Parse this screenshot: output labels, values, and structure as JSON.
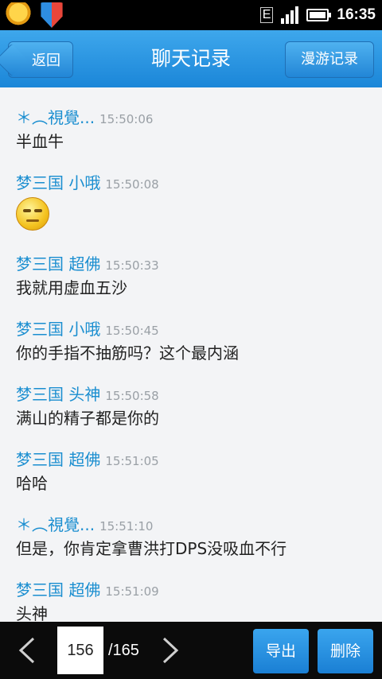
{
  "status_bar": {
    "network_label": "E",
    "time": "16:35"
  },
  "header": {
    "back_label": "返回",
    "title": "聊天记录",
    "roam_label": "漫游记录"
  },
  "messages": [
    {
      "sender": "＊︵視覺...",
      "time": "15:50:06",
      "text": "半血牛"
    },
    {
      "sender": "梦三国 小哦",
      "time": "15:50:08",
      "text": "",
      "emoji": "smug-face-emoji"
    },
    {
      "sender": "梦三国 超佛",
      "time": "15:50:33",
      "text": "我就用虚血五沙"
    },
    {
      "sender": "梦三国 小哦",
      "time": "15:50:45",
      "text": "你的手指不抽筋吗？这个最内涵"
    },
    {
      "sender": "梦三国 头神",
      "time": "15:50:58",
      "text": "满山的精子都是你的"
    },
    {
      "sender": "梦三国 超佛",
      "time": "15:51:05",
      "text": "哈哈"
    },
    {
      "sender": "＊︵視覺...",
      "time": "15:51:10",
      "text": "但是，你肯定拿曹洪打DPS没吸血不行"
    },
    {
      "sender": "梦三国 超佛",
      "time": "15:51:09",
      "text": "头神"
    }
  ],
  "pager": {
    "current_page": "156",
    "total_pages": "/165",
    "export_label": "导出",
    "delete_label": "删除"
  },
  "colors": {
    "accent": "#1b86d8",
    "sender": "#1a8ed0"
  }
}
